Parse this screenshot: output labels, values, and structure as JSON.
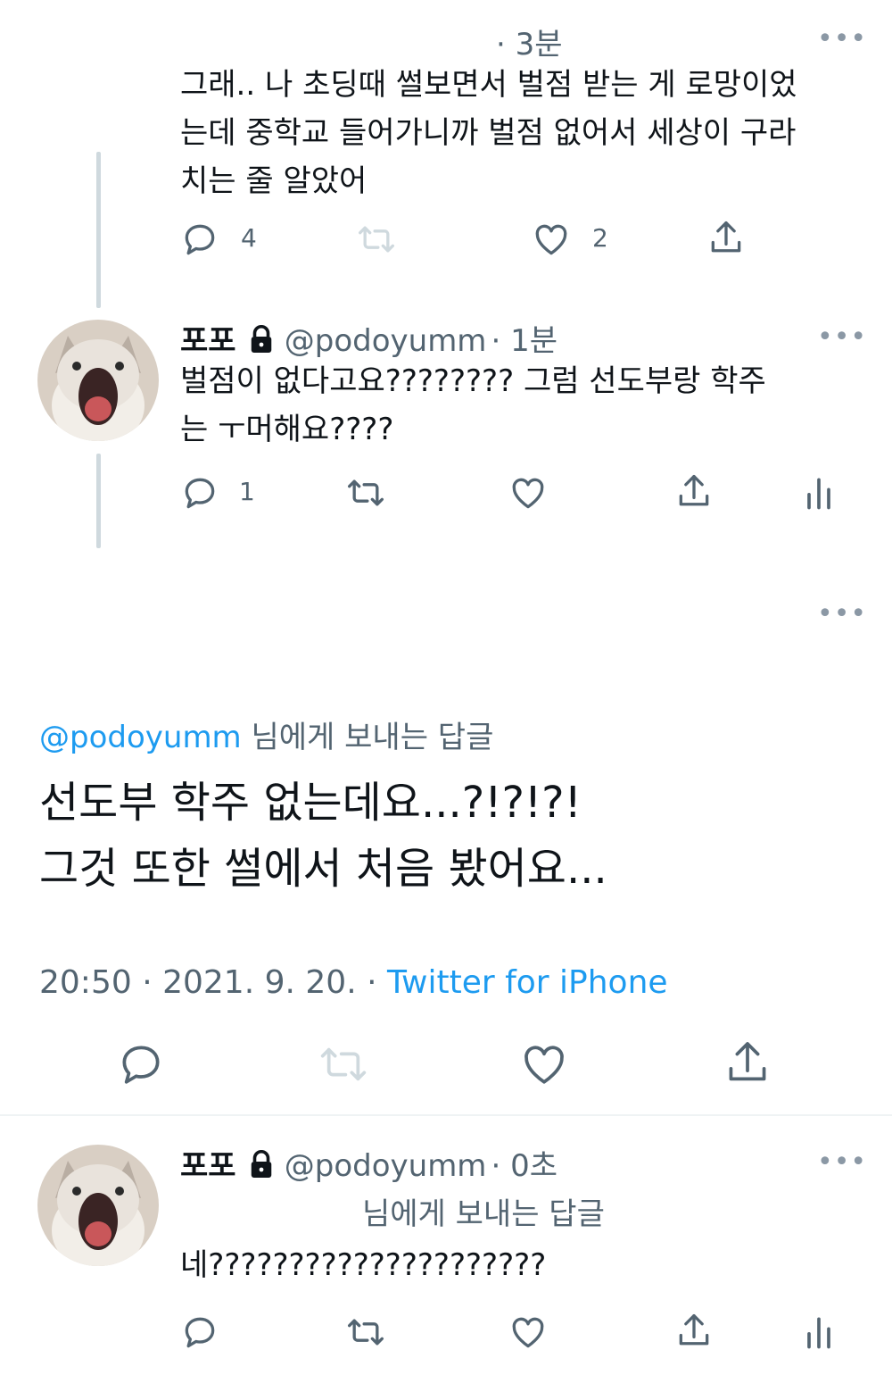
{
  "tweet1": {
    "time": "· 3분",
    "more": "•••",
    "text_lines": [
      "그래.. 나 초딩때 썰보면서 벌점 받는 게 로망이었",
      "는데 중학교 들어가니까 벌점 없어서 세상이 구라",
      "치는 줄 알았어"
    ],
    "reply_count": "4",
    "like_count": "2"
  },
  "tweet2": {
    "name": "포포",
    "handle": "@podoyumm",
    "time": "· 1분",
    "more": "•••",
    "text_lines": [
      "벌점이 없다고요???????? 그럼 선도부랑 학주",
      "는 ㅜ머해요????"
    ],
    "reply_count": "1"
  },
  "main_tweet": {
    "more": "•••",
    "reply_to_handle": "@podoyumm",
    "reply_to_suffix": " 님에게 보내는 답글",
    "text_lines": [
      "선도부 학주 없는데요...?!?!?!",
      "그것 또한 썰에서 처음 봤어요..."
    ],
    "time": "20:50",
    "date": "2021. 9. 20.",
    "source": "Twitter for iPhone"
  },
  "tweet3": {
    "name": "포포",
    "handle": "@podoyumm",
    "time": "· 0초",
    "more": "•••",
    "reply_label": "님에게 보내는 답글",
    "text": "네?????????????????????"
  },
  "colors": {
    "accent": "#1d9bf0",
    "secondary_text": "#536471",
    "thread_line": "#cfd9de",
    "icon_disabled": "#cfd9de"
  }
}
